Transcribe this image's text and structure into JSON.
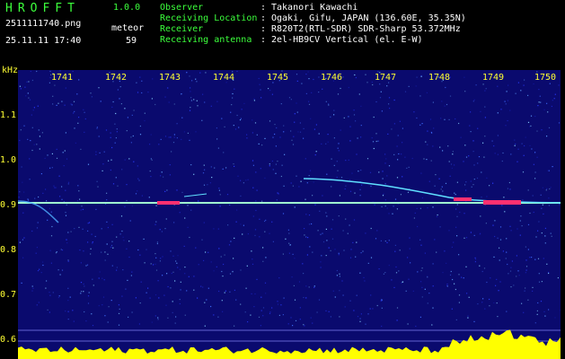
{
  "header": {
    "app_name": "HROFFT",
    "app_version": "1.0.0",
    "file_name": "2511111740.png",
    "timestamp": "25.11.11 17:40",
    "event_type": "meteor",
    "event_count": "59"
  },
  "info": [
    {
      "label": "Observer",
      "value": "Takanori Kawachi"
    },
    {
      "label": "Receiving Location",
      "value": "Ogaki, Gifu, JAPAN (136.60E, 35.35N)"
    },
    {
      "label": "Receiver",
      "value": "R820T2(RTL-SDR) SDR-Sharp 53.372MHz"
    },
    {
      "label": "Receiving antenna",
      "value": "2el-HB9CV Vertical (el. E-W)"
    }
  ],
  "axis": {
    "unit_label": "kHz",
    "x_ticks": [
      "1741",
      "1742",
      "1743",
      "1744",
      "1745",
      "1746",
      "1747",
      "1748",
      "1749",
      "1750"
    ],
    "y_ticks": [
      "1.1",
      "1.0",
      "0.9",
      "0.8",
      "0.7",
      "0.6"
    ]
  },
  "colors": {
    "label": "#3cff3c",
    "value": "#ffffff",
    "axis": "#ffff33",
    "background": "#0a0a6e",
    "carrier": "#a0ffd0",
    "meteor": "#ff3070",
    "noise_floor": "#ffff00"
  }
}
